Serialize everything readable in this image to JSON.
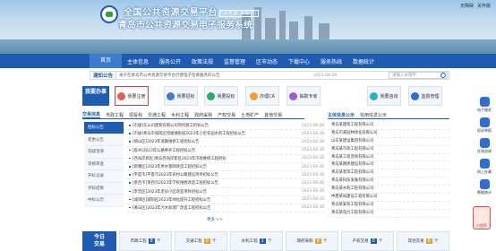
{
  "header": {
    "title_line1": "全国公共资源交易平台",
    "title_tag": "(山东省·青岛市)",
    "title_line2": "青岛市公共资源交易电子服务系统",
    "top_links": [
      "无障碍",
      "关怀版"
    ]
  },
  "nav": {
    "items": [
      "首页",
      "主体信息",
      "服务公开",
      "政策法规",
      "监督管理",
      "区市动态",
      "下载中心",
      "服务热线",
      "数据统计"
    ]
  },
  "notice": {
    "label": "通知公告",
    "text": "关于在青岛市公共资源交易平台行使电子签章服务的公告",
    "date": "2023-08-28",
    "search_placeholder": "请输入关键字"
  },
  "service": {
    "badge": "我要办事",
    "items": [
      "我要注册",
      "我要招标",
      "我要投标",
      "办理CA",
      "抽取专家",
      "我要咨询",
      "监督管理"
    ],
    "colors": [
      "#e85b5b",
      "#3b7fd4",
      "#2fa86b",
      "#f0a030",
      "#9a5cd0",
      "#2ab0c8",
      "#2c6fd0"
    ]
  },
  "tabs_left": [
    "交易信息",
    "市政工程",
    "招投标",
    "交通工程",
    "水利工程",
    "政府采购",
    "产权交易",
    "土地矿产",
    "其他交易"
  ],
  "side_tabs": [
    "招标公告",
    "变更公告",
    "答疑澄清",
    "资格审查",
    "开标记录",
    "评标结果",
    "中标公示"
  ],
  "news_rows": [
    {
      "title": "[市级]东公司建筑有限公司项目施工招标公告",
      "date": "2023-08-28"
    },
    {
      "title": "[市级]青岛市城阳区惜福镇街道2023年小型农田水利工程招标公告",
      "date": "2023-08-28"
    },
    {
      "title": "[崂山区]2023年道路维修工程招标公告",
      "date": "2023-08-28"
    },
    {
      "title": "[胶州]2023年公路养护工程招标公告",
      "date": "2023-08-28"
    },
    {
      "title": "[西海岸新区]青岛西海岸新区2023年市政维修工程招标",
      "date": "2023-08-28"
    },
    {
      "title": "[即墨区]2023年供水管网改造工程招标公告",
      "date": "2023-08-28"
    },
    {
      "title": "[平度市]平度市2023年农村公路建设项目招标公告",
      "date": "2023-08-28"
    },
    {
      "title": "[莱西市]莱西市2023年学校维修改造工程招标公告",
      "date": "2023-08-28"
    },
    {
      "title": "[李沧区]2023年老旧小区改造项目招标公告",
      "date": "2023-08-28"
    },
    {
      "title": "[城阳区]城阳区2023年绿化提升工程招标公告",
      "date": "2023-08-28"
    },
    {
      "title": "[黄岛区]2023年污水处理厂改造工程招标公告",
      "date": "2023-08-28"
    }
  ],
  "more_label": "更多 >>",
  "tabs_right": [
    "主体信息公示",
    "信用信息公示"
  ],
  "company_list": [
    "青岛某建筑工程有限公司",
    "青岛市某园林绿化有限公司",
    "山东某建设集团有限公司",
    "青岛某市政工程有限公司",
    "青岛某工程咨询有限公司",
    "青岛某路桥建设有限公司",
    "青岛某装饰工程有限公司",
    "青岛某科技发展有限公司",
    "青岛某水利工程有限公司",
    "中建某局建设工程有限公司",
    "青岛某安装工程有限公司",
    "青岛某电力工程有限公司"
  ],
  "stats": {
    "today_label": [
      "今日",
      "交易"
    ],
    "items": [
      {
        "label": "市政工程",
        "value": "8",
        "unit": "个"
      },
      {
        "label": "交通工程",
        "value": "0",
        "unit": "个"
      },
      {
        "label": "水利工程",
        "value": "1",
        "unit": "个"
      },
      {
        "label": "政府采购",
        "value": "0",
        "unit": "个"
      },
      {
        "label": "产权交易",
        "value": "0",
        "unit": "个"
      },
      {
        "label": "其他交易",
        "value": "6",
        "unit": "个"
      }
    ]
  },
  "right_bar": [
    "电子服务",
    "投诉举报",
    "在线咨询",
    "网上办事",
    "数据统计"
  ],
  "fish_label": "小程序"
}
